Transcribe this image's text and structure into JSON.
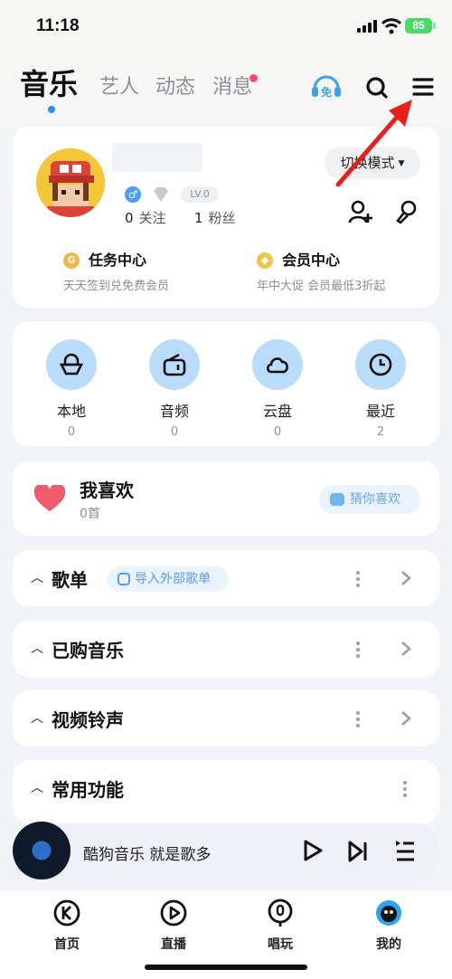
{
  "status_bar": {
    "time": "11:18",
    "battery": "85"
  },
  "nav": {
    "tabs": [
      "音乐",
      "艺人",
      "动态",
      "消息"
    ],
    "active_tab": "音乐"
  },
  "profile": {
    "level": "LV.0",
    "follow_count": "0",
    "follow_label": "关注",
    "fans_count": "1",
    "fans_label": "粉丝",
    "mode_button": "切换模式",
    "task_center": {
      "title": "任务中心",
      "subtitle": "天天签到兑免费会员"
    },
    "vip_center": {
      "title": "会员中心",
      "subtitle": "年中大促 会员最低3折起"
    }
  },
  "shortcuts": [
    {
      "label": "本地",
      "count": "0",
      "icon": "local-icon"
    },
    {
      "label": "音频",
      "count": "0",
      "icon": "radio-icon"
    },
    {
      "label": "云盘",
      "count": "0",
      "icon": "cloud-icon"
    },
    {
      "label": "最近",
      "count": "2",
      "icon": "clock-icon"
    }
  ],
  "favorites": {
    "title": "我喜欢",
    "count": "0首",
    "guess_button": "猜你喜欢"
  },
  "sections": [
    {
      "title": "歌单",
      "extra": "导入外部歌单"
    },
    {
      "title": "已购音乐"
    },
    {
      "title": "视频铃声"
    },
    {
      "title": "常用功能"
    }
  ],
  "player": {
    "song": "酷狗音乐  就是歌多"
  },
  "tabbar": [
    "首页",
    "直播",
    "唱玩",
    "我的"
  ],
  "colors": {
    "accent": "#2d8cff",
    "shortcut_bg": "#b8dcf9",
    "annotation": "#e8201c"
  }
}
